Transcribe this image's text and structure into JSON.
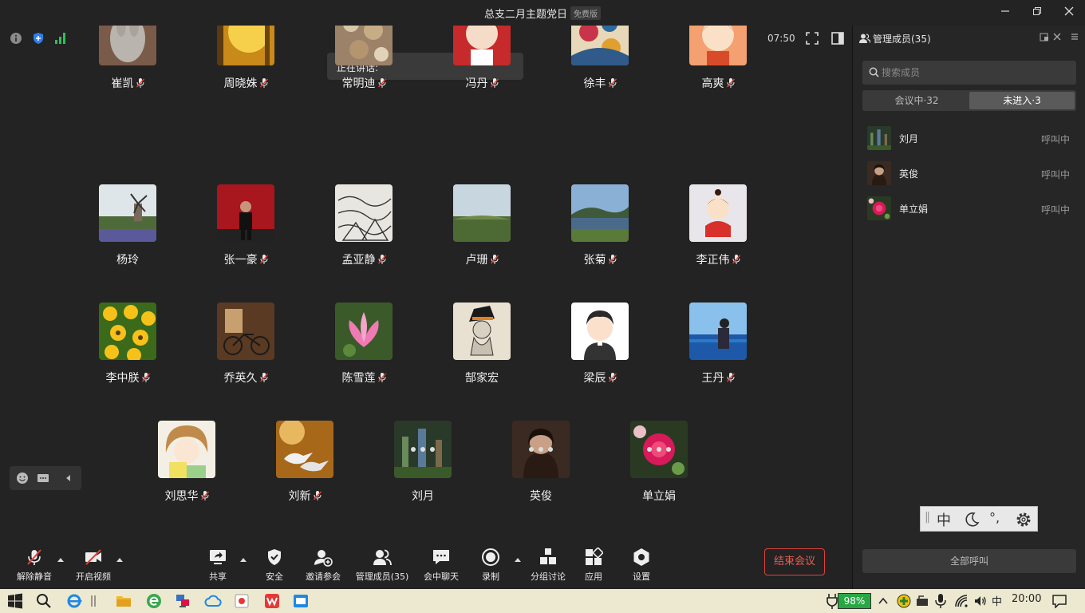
{
  "window": {
    "title": "总支二月主题党日",
    "badge": "免费版"
  },
  "stage": {
    "timer": "07:50",
    "speaking_label": "正在讲话:"
  },
  "participants": [
    {
      "name": "崔凯",
      "muted": true
    },
    {
      "name": "周晓姝",
      "muted": true
    },
    {
      "name": "常明迪",
      "muted": true
    },
    {
      "name": "冯丹",
      "muted": true
    },
    {
      "name": "徐丰",
      "muted": true
    },
    {
      "name": "高爽",
      "muted": true
    },
    {
      "name": "杨玲",
      "muted": false
    },
    {
      "name": "张一豪",
      "muted": true
    },
    {
      "name": "孟亚静",
      "muted": true
    },
    {
      "name": "卢珊",
      "muted": true
    },
    {
      "name": "张菊",
      "muted": true
    },
    {
      "name": "李正伟",
      "muted": true
    },
    {
      "name": "李中朕",
      "muted": true
    },
    {
      "name": "乔英久",
      "muted": true
    },
    {
      "name": "陈雪莲",
      "muted": true
    },
    {
      "name": "郜家宏",
      "muted": false
    },
    {
      "name": "梁辰",
      "muted": true
    },
    {
      "name": "王丹",
      "muted": true
    },
    {
      "name": "刘思华",
      "muted": true
    },
    {
      "name": "刘新",
      "muted": true
    },
    {
      "name": "刘月",
      "muted": false,
      "connecting": true
    },
    {
      "name": "英俊",
      "muted": false,
      "connecting": true
    },
    {
      "name": "单立娟",
      "muted": false,
      "connecting": true
    }
  ],
  "toolbar": {
    "unmute": "解除静音",
    "start_video": "开启视频",
    "share": "共享",
    "security": "安全",
    "invite": "邀请参会",
    "manage_members": "管理成员(35)",
    "chat": "会中聊天",
    "record": "录制",
    "breakout": "分组讨论",
    "apps": "应用",
    "settings": "设置",
    "end_meeting": "结束会议"
  },
  "panel": {
    "title": "管理成员(35)",
    "search_placeholder": "搜索成员",
    "tab_in_meeting": "会议中·32",
    "tab_not_joined": "未进入·3",
    "members": [
      {
        "name": "刘月",
        "status": "呼叫中"
      },
      {
        "name": "英俊",
        "status": "呼叫中"
      },
      {
        "name": "单立娟",
        "status": "呼叫中"
      }
    ],
    "call_all": "全部呼叫"
  },
  "ime": {
    "mode": "中",
    "punct": "°,"
  },
  "taskbar": {
    "battery": "98%",
    "lang": "中",
    "clock": "20:00"
  },
  "colors": {
    "background": "#232323",
    "panel": "#262626",
    "end_meeting": "#e0413a",
    "battery": "#2aa745"
  }
}
